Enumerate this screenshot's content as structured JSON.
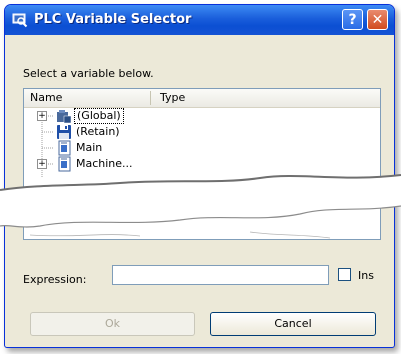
{
  "window": {
    "title": "PLC Variable Selector",
    "help_glyph": "?",
    "close_glyph": "✕",
    "icon": "magnifier-computer-icon"
  },
  "instruction": "Select a variable below.",
  "tree": {
    "columns": [
      "Name",
      "Type"
    ],
    "nodes": [
      {
        "label": "(Global)",
        "icon": "global-folder-icon",
        "expandable": true,
        "expander": "+"
      },
      {
        "label": "(Retain)",
        "icon": "floppy-disk-icon",
        "expandable": false
      },
      {
        "label": "Main",
        "icon": "program-icon",
        "expandable": false
      },
      {
        "label": "Machine...",
        "icon": "program-icon",
        "expandable": true,
        "expander": "+"
      }
    ]
  },
  "expression": {
    "label": "Expression:",
    "value": ""
  },
  "ins_checkbox": {
    "label": "Ins",
    "checked": false
  },
  "buttons": {
    "ok": "Ok",
    "cancel": "Cancel"
  }
}
